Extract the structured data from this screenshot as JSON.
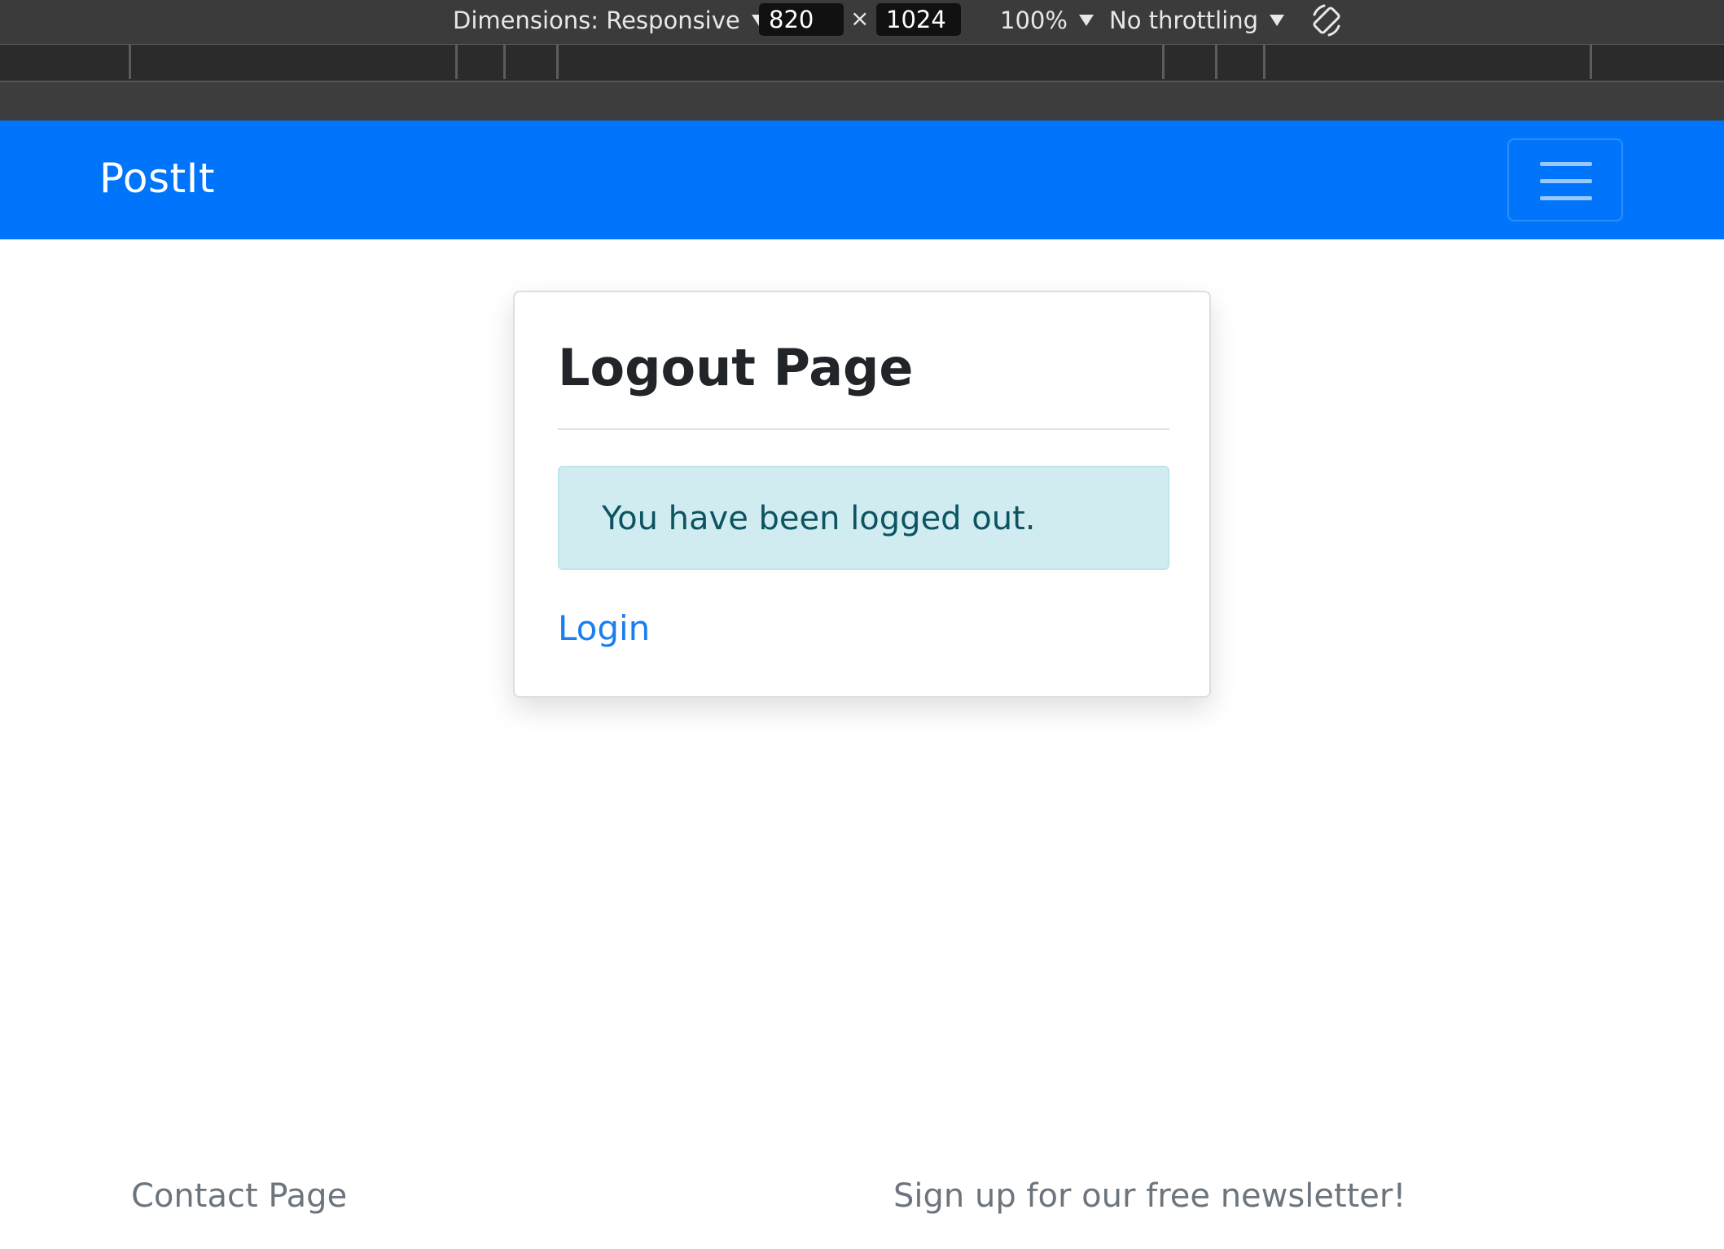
{
  "devtools": {
    "dimensions_label": "Dimensions: Responsive",
    "width_value": "820",
    "times_symbol": "×",
    "height_value": "1024",
    "zoom_label": "100%",
    "throttling_label": "No throttling",
    "icons": {
      "rotate": "rotate-device-icon",
      "caret": "caret-down-icon"
    },
    "colors": {
      "toolbar_bg": "#3b3b3b",
      "ruler_bg": "#2b2b2b"
    }
  },
  "navbar": {
    "brand": "PostIt",
    "toggler_icon": "hamburger-menu-icon",
    "color": "#0075fb"
  },
  "card": {
    "title": "Logout Page",
    "alert_message": "You have been logged out.",
    "login_link": "Login",
    "colors": {
      "alert_bg": "#d1ecf1",
      "alert_text": "#0c5460",
      "link": "#1a7ef0"
    }
  },
  "footer": {
    "contact_link": "Contact Page",
    "newsletter_link": "Sign up for our free newsletter!"
  }
}
